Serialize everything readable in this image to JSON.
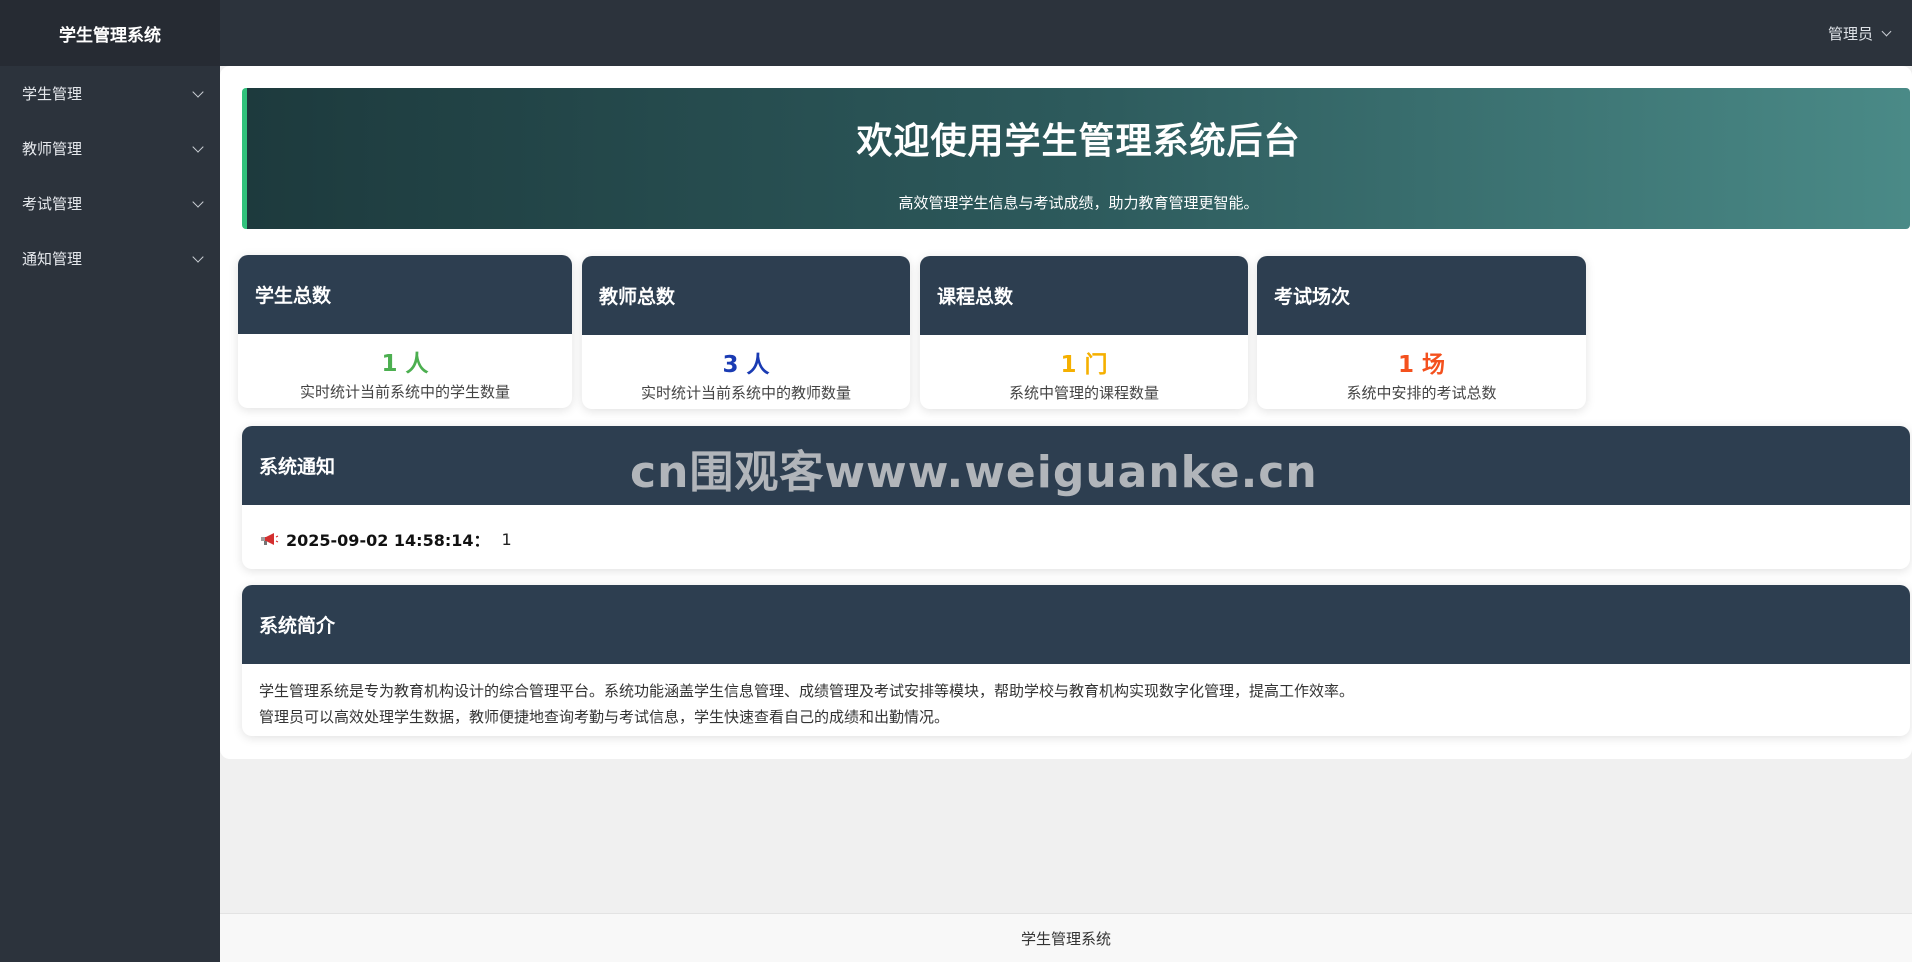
{
  "sidebar": {
    "brand": "学生管理系统",
    "items": [
      {
        "label": "学生管理"
      },
      {
        "label": "教师管理"
      },
      {
        "label": "考试管理"
      },
      {
        "label": "通知管理"
      }
    ]
  },
  "header": {
    "user_label": "管理员"
  },
  "banner": {
    "title": "欢迎使用学生管理系统后台",
    "subtitle": "高效管理学生信息与考试成绩，助力教育管理更智能。"
  },
  "stats": [
    {
      "title": "学生总数",
      "value": "1 人",
      "desc": "实时统计当前系统中的学生数量",
      "color": "#4caf50"
    },
    {
      "title": "教师总数",
      "value": "3 人",
      "desc": "实时统计当前系统中的教师数量",
      "color": "#1a3bb3"
    },
    {
      "title": "课程总数",
      "value": "1 门",
      "desc": "系统中管理的课程数量",
      "color": "#f5b000"
    },
    {
      "title": "考试场次",
      "value": "1 场",
      "desc": "系统中安排的考试总数",
      "color": "#f4511e"
    }
  ],
  "notices": {
    "title": "系统通知",
    "watermark": "cn围观客www.weiguanke.cn",
    "items": [
      {
        "time": "2025-09-02 14:58:14：",
        "text": "1",
        "icon": "megaphone-icon"
      }
    ]
  },
  "intro": {
    "title": "系统简介",
    "lines": [
      "学生管理系统是专为教育机构设计的综合管理平台。系统功能涵盖学生信息管理、成绩管理及考试安排等模块，帮助学校与教育机构实现数字化管理，提高工作效率。",
      "管理员可以高效处理学生数据，教师便捷地查询考勤与考试信息，学生快速查看自己的成绩和出勤情况。"
    ]
  },
  "footer": {
    "text": "学生管理系统"
  },
  "colors": {
    "sidebar_bg": "#2c333c",
    "card_header_bg": "#2d3e50",
    "banner_accent": "#31c27c"
  }
}
